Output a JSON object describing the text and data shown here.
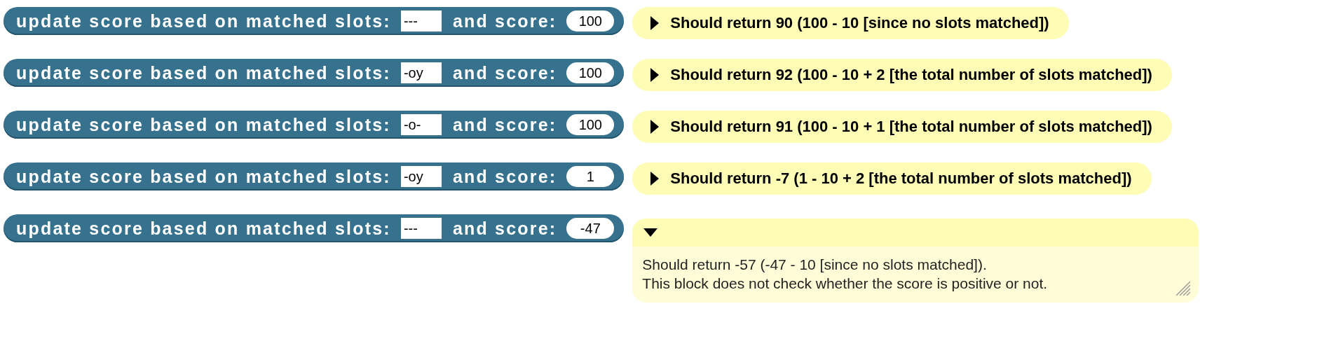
{
  "rows": [
    {
      "block": {
        "label": "update score based on matched slots:",
        "slots": "---",
        "and_label": "and score:",
        "score": "100"
      },
      "comment": {
        "expanded": false,
        "lines": [
          "Should return 90 (100 - 10 [since no slots matched])"
        ]
      }
    },
    {
      "block": {
        "label": "update score based on matched slots:",
        "slots": "-oy",
        "and_label": "and score:",
        "score": "100"
      },
      "comment": {
        "expanded": false,
        "lines": [
          "Should return 92 (100 - 10 + 2 [the total number of slots matched])"
        ]
      }
    },
    {
      "block": {
        "label": "update score based on matched slots:",
        "slots": "-o-",
        "and_label": "and score:",
        "score": "100"
      },
      "comment": {
        "expanded": false,
        "lines": [
          "Should return 91 (100 - 10 + 1 [the total number of slots matched])"
        ]
      }
    },
    {
      "block": {
        "label": "update score based on matched slots:",
        "slots": "-oy",
        "and_label": "and score:",
        "score": "1"
      },
      "comment": {
        "expanded": false,
        "lines": [
          "Should return -7 (1 - 10 + 2 [the total number of slots matched])"
        ]
      }
    },
    {
      "block": {
        "label": "update score based on matched slots:",
        "slots": "---",
        "and_label": "and score:",
        "score": "-47"
      },
      "comment": {
        "expanded": true,
        "lines": [
          "Should return -57 (-47 - 10 [since no slots matched]).",
          "This block does not check whether the score is positive or not."
        ]
      }
    }
  ]
}
